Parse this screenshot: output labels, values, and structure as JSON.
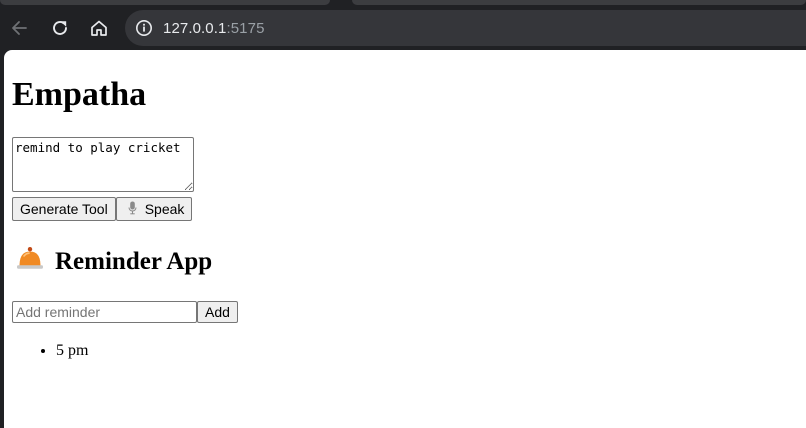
{
  "browser": {
    "url_host": "127.0.0.1",
    "url_port": ":5175"
  },
  "page": {
    "title": "Empatha",
    "prompt_value": "remind to play cricket",
    "generate_label": "Generate Tool",
    "speak_label": "Speak",
    "reminder_app": {
      "title": "Reminder App",
      "input_placeholder": "Add reminder",
      "add_label": "Add",
      "items": [
        "5 pm"
      ]
    }
  },
  "icons": {
    "back": "back-arrow-icon",
    "reload": "reload-icon",
    "home": "home-icon",
    "site_info": "info-icon",
    "mic": "microphone-icon",
    "bell": "bell-icon"
  }
}
